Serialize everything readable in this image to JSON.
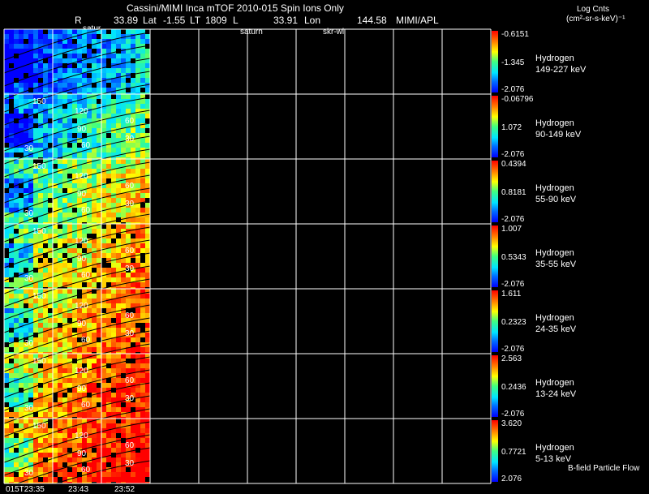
{
  "header": {
    "title": "Cassini/MIMI Inca mTOF  2010-015   Spin    Ions Only",
    "r_label": "R",
    "r_value": "33.89",
    "lat_label": "Lat",
    "lat_value": "-1.55",
    "lt_label": "LT",
    "lt_value": "1809",
    "l_label": "L",
    "l_value": "33.91",
    "lon_label": "Lon",
    "lon_value": "144.58",
    "institution": "MIMI/APL",
    "units_line1": "Log Cnts",
    "units_line2": "(cm²-sr-s-keV)⁻¹",
    "marker_satur": "satur",
    "marker_saturn": "saturn",
    "marker_skr": "skr-wl"
  },
  "footer": {
    "t1": "015T23:35",
    "t2": "23:43",
    "t3": "23:52",
    "bfield": "B-field Particle Flow"
  },
  "colors": {
    "background": "#000000",
    "grid": "#ffffff"
  },
  "chart_data": {
    "type": "heatmap",
    "time_labels": [
      "015T23:35",
      "23:43",
      "23:52"
    ],
    "contour_labels": [
      "150",
      "120",
      "90",
      "60",
      "30"
    ],
    "series": [
      {
        "species": "Hydrogen",
        "energy": "149-227 keV",
        "cmax": "-0.6151",
        "cmid": "-1.345",
        "cmin": "-2.076",
        "level": 0.12
      },
      {
        "species": "Hydrogen",
        "energy": "90-149 keV",
        "cmax": "-0.06796",
        "cmid": "1.072",
        "cmin": "-2.076",
        "level": 0.3
      },
      {
        "species": "Hydrogen",
        "energy": "55-90 keV",
        "cmax": "0.4394",
        "cmid": "0.8181",
        "cmin": "-2.076",
        "level": 0.5
      },
      {
        "species": "Hydrogen",
        "energy": "35-55 keV",
        "cmax": "1.007",
        "cmid": "0.5343",
        "cmin": "-2.076",
        "level": 0.6
      },
      {
        "species": "Hydrogen",
        "energy": "24-35 keV",
        "cmax": "1.611",
        "cmid": "0.2323",
        "cmin": "-2.076",
        "level": 0.68
      },
      {
        "species": "Hydrogen",
        "energy": "13-24 keV",
        "cmax": "2.563",
        "cmid": "0.2436",
        "cmin": "-2.076",
        "level": 0.75
      },
      {
        "species": "Hydrogen",
        "energy": "5-13 keV",
        "cmax": "3.620",
        "cmid": "0.7721",
        "cmin": "2.076",
        "level": 0.82
      }
    ]
  }
}
